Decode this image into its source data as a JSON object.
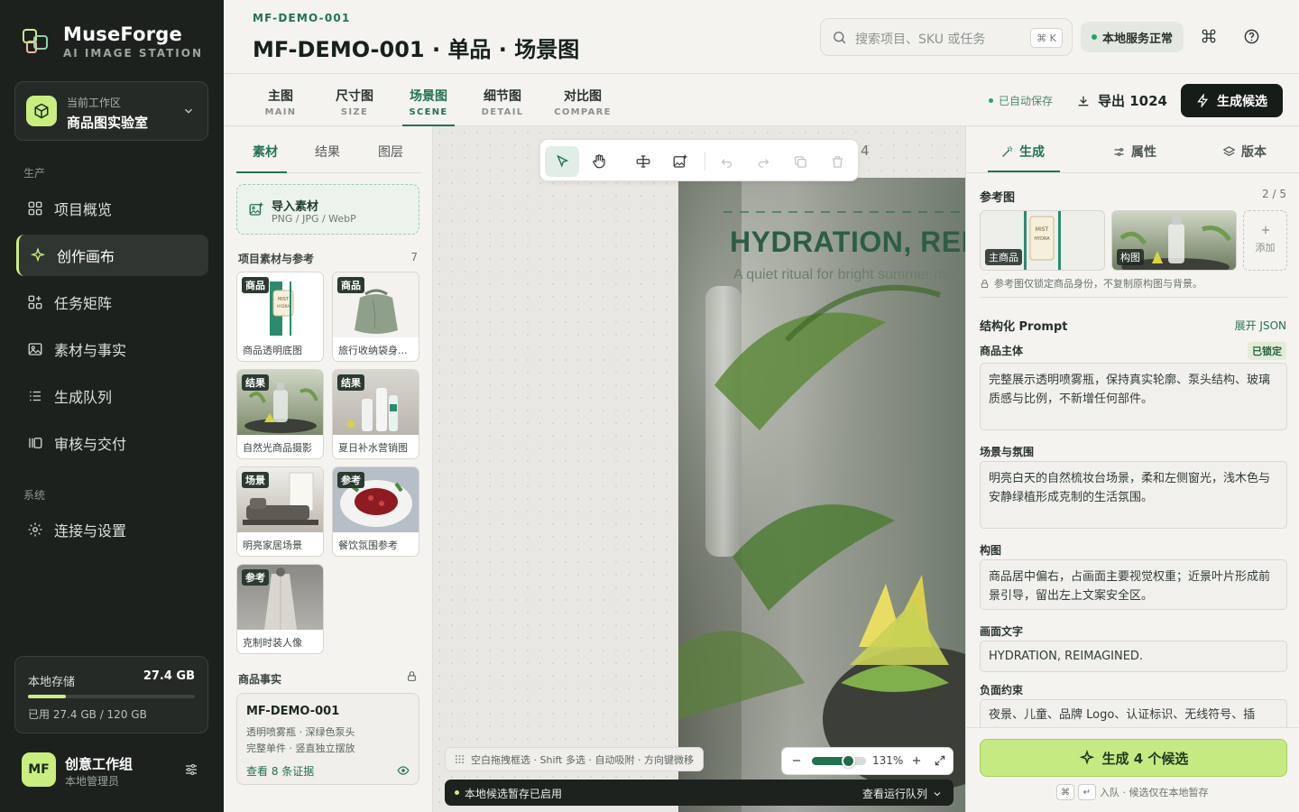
{
  "brand": {
    "name": "MuseForge",
    "subtitle": "AI IMAGE STATION"
  },
  "workspace": {
    "label": "当前工作区",
    "name": "商品图实验室"
  },
  "nav": {
    "section1": "生产",
    "items1": [
      "项目概览",
      "创作画布",
      "任务矩阵",
      "素材与事实",
      "生成队列",
      "审核与交付"
    ],
    "section2": "系统",
    "items2": [
      "连接与设置"
    ],
    "active": "创作画布"
  },
  "storage": {
    "label": "本地存储",
    "value": "27.4 GB",
    "detail": "已用 27.4 GB / 120 GB",
    "used_fraction": 0.228
  },
  "user": {
    "initials": "MF",
    "name": "创意工作组",
    "role": "本地管理员"
  },
  "header": {
    "sku": "MF-DEMO-001",
    "title": "MF-DEMO-001 · 单品 · 场景图",
    "search_placeholder": "搜索项目、SKU 或任务",
    "search_kbd": "⌘ K",
    "status": "本地服务正常"
  },
  "tabs": [
    {
      "zh": "主图",
      "en": "MAIN"
    },
    {
      "zh": "尺寸图",
      "en": "SIZE"
    },
    {
      "zh": "场景图",
      "en": "SCENE"
    },
    {
      "zh": "细节图",
      "en": "DETAIL"
    },
    {
      "zh": "对比图",
      "en": "COMPARE"
    }
  ],
  "tabs_active": "场景图",
  "toolbar_right": {
    "autosave": "已自动保存",
    "export": "导出 1024",
    "generate": "生成候选"
  },
  "left_panel": {
    "tabs": [
      "素材",
      "结果",
      "图层"
    ],
    "import_title": "导入素材",
    "import_sub": "PNG / JPG / WebP",
    "assets_title": "项目素材与参考",
    "assets_count": "7",
    "assets": [
      {
        "badge": "商品",
        "caption": "商品透明底图"
      },
      {
        "badge": "商品",
        "caption": "旅行收纳袋身..."
      },
      {
        "badge": "结果",
        "caption": "自然光商品摄影"
      },
      {
        "badge": "结果",
        "caption": "夏日补水营销图"
      },
      {
        "badge": "场景",
        "caption": "明亮家居场景"
      },
      {
        "badge": "参考",
        "caption": "餐饮氛围参考"
      },
      {
        "badge": "参考",
        "caption": "克制时装人像"
      }
    ],
    "facts_title": "商品事实",
    "facts": {
      "sku": "MF-DEMO-001",
      "line1": "透明喷雾瓶 · 深绿色泵头",
      "line2": "完整单件 · 竖直独立摆放",
      "link": "查看 8 条证据"
    }
  },
  "canvas": {
    "artboard_number": "4",
    "headline": "HYDRATION, REI",
    "subline": "A quiet ritual for bright summer mo",
    "hint": "空白拖拽框选 · Shift 多选 · 自动吸附 · 方向键微移",
    "zoom": "131%",
    "zoom_fraction": 0.66,
    "notice": "本地候选暂存已启用",
    "notice_link": "查看运行队列"
  },
  "right_panel": {
    "tabs": [
      "生成",
      "属性",
      "版本"
    ],
    "ref_title": "参考图",
    "ref_count": "2 / 5",
    "refs": [
      "主商品",
      "构图"
    ],
    "add_label": "添加",
    "ref_note": "参考图仅锁定商品身份，不复制原构图与背景。",
    "prompt_title": "结构化 Prompt",
    "expand_json": "展开 JSON",
    "fields": [
      {
        "label": "商品主体",
        "value": "完整展示透明喷雾瓶，保持真实轮廓、泵头结构、玻璃质感与比例，不新增任何部件。",
        "locked": "已锁定"
      },
      {
        "label": "场景与氛围",
        "value": "明亮白天的自然梳妆台场景，柔和左侧窗光，浅木色与安静绿植形成克制的生活氛围。"
      },
      {
        "label": "构图",
        "value": "商品居中偏右，占画面主要视觉权重；近景叶片形成前景引导，留出左上文案安全区。"
      },
      {
        "label": "画面文字",
        "value": "HYDRATION, REIMAGINED."
      },
      {
        "label": "负面约束",
        "value": "夜景、儿童、品牌 Logo、认证标识、无线符号、插头、"
      }
    ],
    "generate_btn": "生成 4 个候选",
    "footer": "入队 · 候选仅在本地暂存",
    "footer_keys": [
      "⌘",
      "↵"
    ]
  },
  "colors": {
    "accent": "#23724f",
    "lime": "#c9ee7f",
    "sidebar": "#1d211e"
  }
}
